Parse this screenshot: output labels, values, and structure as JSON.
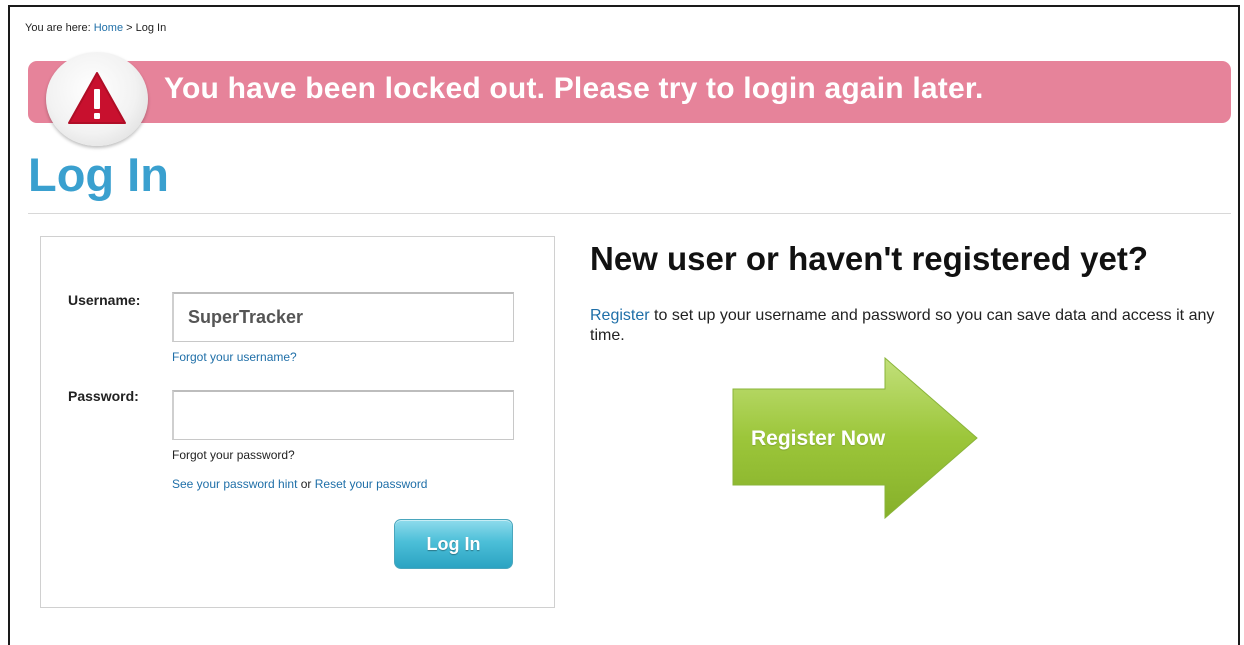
{
  "breadcrumb": {
    "prefix": "You are here:",
    "home": "Home",
    "separator": ">",
    "current": "Log In"
  },
  "alert": {
    "message": "You have been locked out. Please try to login again later.",
    "icon": "warning-triangle-icon",
    "color": "#e6839a"
  },
  "page": {
    "title": "Log In",
    "title_color": "#3aa0cf"
  },
  "login_form": {
    "username_label": "Username:",
    "username_value": "SuperTracker",
    "forgot_username": "Forgot your username?",
    "password_label": "Password:",
    "password_value": "",
    "forgot_password": "Forgot your password?",
    "password_hint_link": "See your password hint",
    "or_text": "or",
    "reset_password_link": "Reset your password",
    "login_button": "Log In"
  },
  "register": {
    "heading": "New user or haven't registered yet?",
    "link": "Register",
    "text": "to set up your username and password so you can save data and access it any time.",
    "button": "Register Now",
    "button_color": "#9cc63a"
  }
}
